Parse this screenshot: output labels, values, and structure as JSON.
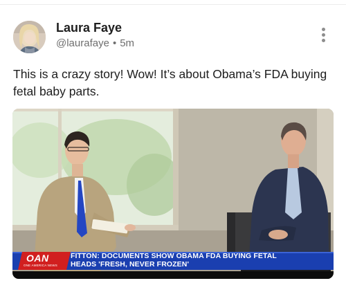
{
  "post": {
    "author": {
      "name": "Laura Faye",
      "handle": "@laurafaye",
      "separator": "•",
      "timestamp": "5m",
      "avatar_icon": "user-avatar-photo"
    },
    "more_icon": "kebab-vertical-icon",
    "text": "This is a crazy story! Wow! It’s about Obama’s FDA buying fetal baby parts.",
    "media": {
      "type": "video-still",
      "broadcaster": "OAN",
      "broadcaster_tagline": "ONE AMERICA NEWS",
      "chyron_line1": "FITTON: DOCUMENTS SHOW OBAMA FDA BUYING FETAL",
      "chyron_line2": "HEADS 'FRESH, NEVER FROZEN'",
      "colors": {
        "chyron_blue": "#1a3fb0",
        "oan_red": "#d11f1f"
      }
    }
  }
}
